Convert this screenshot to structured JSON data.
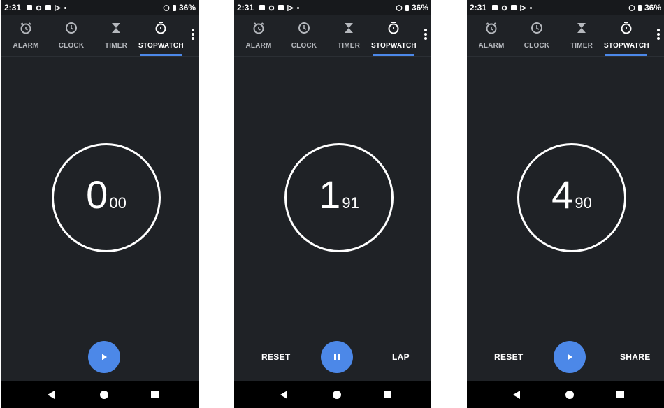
{
  "status": {
    "time": "2:31",
    "battery": "36%"
  },
  "tabs": {
    "alarm": "ALARM",
    "clock": "CLOCK",
    "timer": "TIMER",
    "stopwatch": "STOPWATCH"
  },
  "screens": [
    {
      "seconds": "0",
      "hundredths": "00",
      "fab_icon": "play-icon",
      "left_button": "",
      "right_button": ""
    },
    {
      "seconds": "1",
      "hundredths": "91",
      "fab_icon": "pause-icon",
      "left_button": "RESET",
      "right_button": "LAP"
    },
    {
      "seconds": "4",
      "hundredths": "90",
      "fab_icon": "play-icon",
      "left_button": "RESET",
      "right_button": "SHARE"
    }
  ],
  "colors": {
    "background": "#1f2226",
    "accent": "#4c88e8",
    "navbar": "#000000",
    "text": "#ffffff"
  }
}
